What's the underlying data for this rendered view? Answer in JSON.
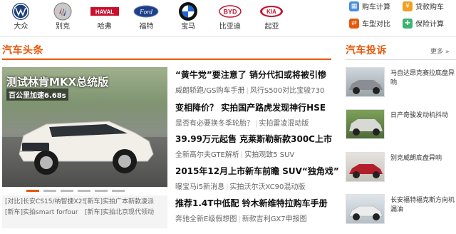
{
  "brands": [
    {
      "name": "大众",
      "icon": "vw-logo-icon"
    },
    {
      "name": "别克",
      "icon": "buick-logo-icon"
    },
    {
      "name": "哈弗",
      "icon": "haval-logo-icon",
      "logo_text": "HAVAL"
    },
    {
      "name": "福特",
      "icon": "ford-logo-icon",
      "logo_text": "Ford"
    },
    {
      "name": "宝马",
      "icon": "bmw-logo-icon"
    },
    {
      "name": "比亚迪",
      "icon": "byd-logo-icon",
      "logo_text": "BYD"
    },
    {
      "name": "起亚",
      "icon": "kia-logo-icon",
      "logo_text": "KIA"
    }
  ],
  "tools": {
    "car_calc": {
      "label": "购车计算",
      "icon": "calculator-icon",
      "color": "#4a8fd9"
    },
    "loan_calc": {
      "label": "贷款购车",
      "icon": "money-icon",
      "color": "#f0a020"
    },
    "compare": {
      "label": "车型对比",
      "icon": "compare-icon",
      "color": "#e8580c"
    },
    "insurance": {
      "label": "保险计算",
      "icon": "insurance-icon",
      "color": "#3cb371"
    }
  },
  "headlines_section": {
    "title": "汽车头条"
  },
  "complaints_section": {
    "title": "汽车投诉",
    "more": "更多 »"
  },
  "hero": {
    "caption": "测试林肯MKX总统版",
    "sub": "百公里加速6.68s",
    "dots": [
      true,
      false,
      false,
      false,
      false,
      false
    ]
  },
  "minilinks": [
    [
      "[对比]长安CS15/纳智捷X25",
      "[新车]实拍广本新款凌派"
    ],
    [
      "[新车]实拍smart forfour",
      "[新车]实拍北京现代领动"
    ]
  ],
  "news": [
    {
      "headline": "“黄牛党”要注意了 销分代扣或将被引惨",
      "subs": [
        "威朗轿跑/GS购车手册",
        "风行S500对比宝骏730"
      ]
    },
    {
      "headline": "变相降价？ 实拍国产路虎发现神行HSE",
      "subs": [
        "是否有必要换冬季轮胎？",
        "实拍雷凌混动版"
      ]
    },
    {
      "headline": "39.99万元起售 克莱斯勒新款300C上市",
      "subs": [
        "全新高尔夫GTE解析",
        "实拍观致5 SUV"
      ]
    },
    {
      "headline": "2015年12月上市新车前瞻 SUV“独角戏”",
      "subs": [
        "曝宝马i5新消息",
        "实拍沃尔沃XC90混动版"
      ]
    },
    {
      "headline": "推荐1.4T中低配 铃木新维特拉购车手册",
      "subs": [
        "奔驰全新E级假想图",
        "新款吉利GX7申报图"
      ]
    }
  ],
  "complaints": [
    {
      "text": "马自达昂克赛拉底盘异响",
      "car_color": "#8a8e94"
    },
    {
      "text": "日产奇骏发动机抖动",
      "car_color": "#d8d8d4"
    },
    {
      "text": "别克威朗底盘异响",
      "car_color": "#b21f2a"
    },
    {
      "text": "长安福特福克斯方向机漏油",
      "car_color": "#e8e8e8"
    }
  ]
}
